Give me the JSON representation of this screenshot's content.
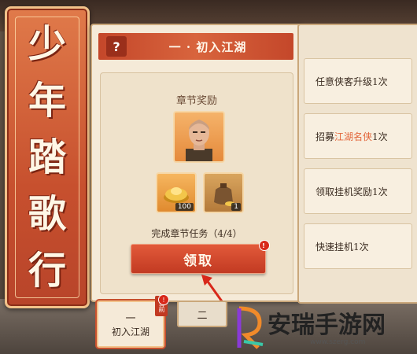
{
  "title_banner": {
    "chars": [
      "少",
      "年",
      "踏",
      "歌",
      "行"
    ]
  },
  "panel": {
    "help_label": "?",
    "header_title": "一 · 初入江湖",
    "reward_label": "章节奖励",
    "rewards": [
      {
        "icon": "gold-ingot-icon",
        "count": "100"
      },
      {
        "icon": "coin-bag-icon",
        "count": "1"
      }
    ],
    "task_progress": "完成章节任务（4/4）",
    "claim_label": "领取",
    "claim_dot": "!"
  },
  "tasks": [
    {
      "pre": "任意侠客升级1次",
      "hl": "",
      "post": ""
    },
    {
      "pre": "招募",
      "hl": "江湖名侠",
      "post": "1次"
    },
    {
      "pre": "领取挂机奖励1次",
      "hl": "",
      "post": ""
    },
    {
      "pre": "快速挂机1次",
      "hl": "",
      "post": ""
    }
  ],
  "chapters": [
    {
      "num": "一",
      "name": "初入江湖",
      "badge": "当前"
    },
    {
      "num": "二",
      "name": ""
    }
  ],
  "watermark": {
    "name": "安瑞手游网",
    "url": "www.szerg.com"
  },
  "colors": {
    "accent": "#c4472a",
    "highlight": "#e2653a",
    "panel": "#f5ead8"
  }
}
